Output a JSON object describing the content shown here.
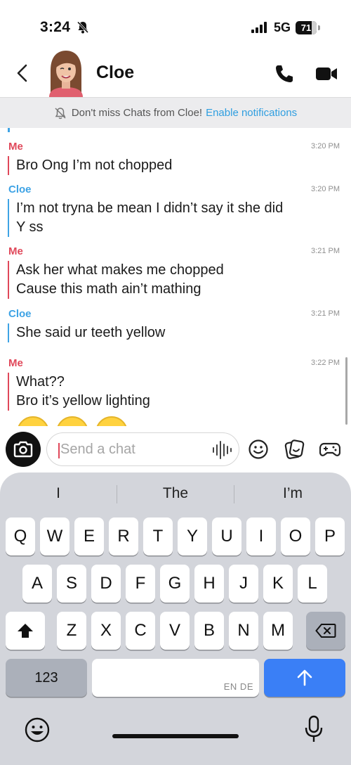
{
  "status": {
    "time": "3:24",
    "network": "5G",
    "battery": "71"
  },
  "header": {
    "contact_name": "Cloe"
  },
  "banner": {
    "text": "Don't miss Chats from Cloe!",
    "link": "Enable notifications"
  },
  "messages": [
    {
      "sender": "Me",
      "time": "3:20 PM",
      "lines": [
        "Bro Ong I’m not chopped"
      ]
    },
    {
      "sender": "Cloe",
      "time": "3:20 PM",
      "lines": [
        "I’m not tryna be mean I didn’t say it she did",
        "Y ss"
      ]
    },
    {
      "sender": "Me",
      "time": "3:21 PM",
      "lines": [
        "Ask her what makes me chopped",
        "Cause this math ain’t mathing"
      ]
    },
    {
      "sender": "Cloe",
      "time": "3:21 PM",
      "lines": [
        "She said ur teeth yellow"
      ]
    },
    {
      "sender": "Me",
      "time": "3:22 PM",
      "lines": [
        "What??",
        "Bro it’s yellow lighting"
      ]
    }
  ],
  "composer": {
    "placeholder": "Send a chat"
  },
  "keyboard": {
    "suggestions": [
      "I",
      "The",
      "I’m"
    ],
    "row1": [
      "Q",
      "W",
      "E",
      "R",
      "T",
      "Y",
      "U",
      "I",
      "O",
      "P"
    ],
    "row2": [
      "A",
      "S",
      "D",
      "F",
      "G",
      "H",
      "J",
      "K",
      "L"
    ],
    "row3": [
      "Z",
      "X",
      "C",
      "V",
      "B",
      "N",
      "M"
    ],
    "numbers_key": "123",
    "space_language": "EN DE"
  },
  "colors": {
    "me": "#e0485a",
    "cloe": "#3ea3e5",
    "link": "#2f9ee0",
    "send_key": "#3a7ff6"
  }
}
